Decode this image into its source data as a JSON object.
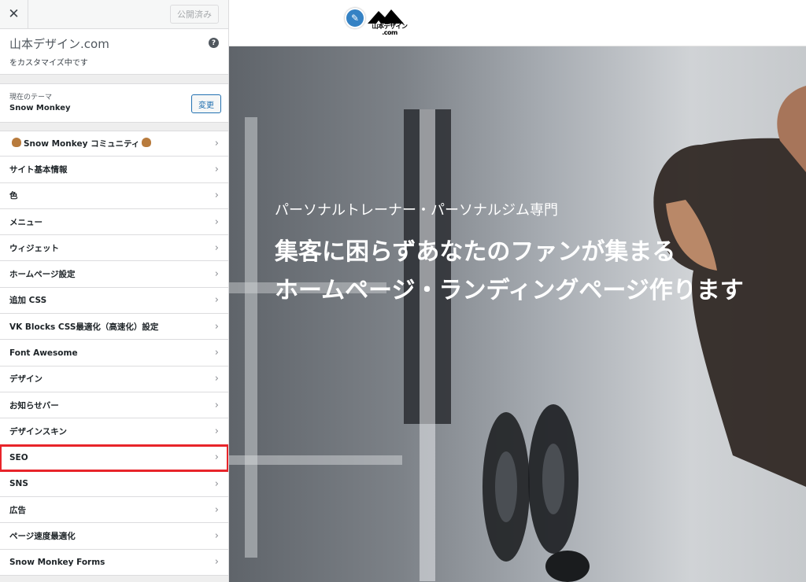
{
  "sidebar": {
    "close_icon": "close-icon",
    "publish_label": "公開済み",
    "site_title": "山本デザイン.com",
    "site_sub": "をカスタマイズ中です",
    "help_symbol": "?",
    "theme_label": "現在のテーマ",
    "theme_name": "Snow Monkey",
    "change_label": "変更",
    "items": [
      {
        "label": "Snow Monkey コミュニティ"
      },
      {
        "label": "サイト基本情報"
      },
      {
        "label": "色"
      },
      {
        "label": "メニュー"
      },
      {
        "label": "ウィジェット"
      },
      {
        "label": "ホームページ設定"
      },
      {
        "label": "追加 CSS"
      },
      {
        "label": "VK Blocks CSS最適化（高速化）設定"
      },
      {
        "label": "Font Awesome"
      },
      {
        "label": "デザイン"
      },
      {
        "label": "お知らせバー"
      },
      {
        "label": "デザインスキン"
      },
      {
        "label": "SEO"
      },
      {
        "label": "SNS"
      },
      {
        "label": "広告"
      },
      {
        "label": "ページ速度最適化"
      },
      {
        "label": "Snow Monkey Forms"
      }
    ],
    "chevron": "›",
    "highlight_color": "#e8242a"
  },
  "preview": {
    "logo_text": "山本デザイン",
    "logo_sub": ".com",
    "hero_line1": "パーソナルトレーナー・パーソナルジム専門",
    "hero_line2": "集客に困らずあなたのファンが集まる",
    "hero_line3": "ホームページ・ランディングページ作ります"
  }
}
